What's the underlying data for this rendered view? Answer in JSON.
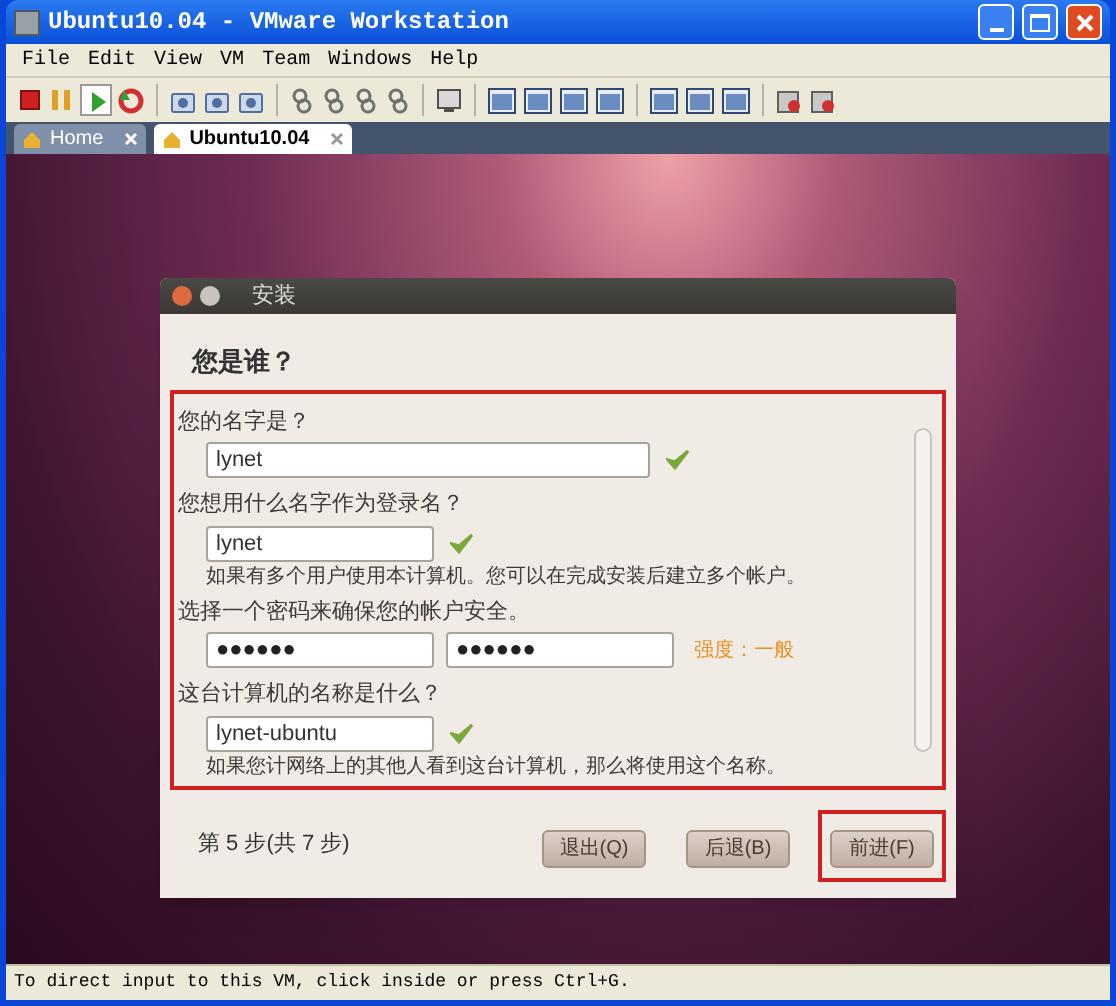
{
  "window": {
    "title": "Ubuntu10.04 - VMware Workstation"
  },
  "menu": [
    "File",
    "Edit",
    "View",
    "VM",
    "Team",
    "Windows",
    "Help"
  ],
  "toolbar": [
    {
      "kind": "stop"
    },
    {
      "kind": "pause"
    },
    {
      "kind": "play"
    },
    {
      "kind": "reset"
    },
    {
      "kind": "sep"
    },
    {
      "kind": "snapshot"
    },
    {
      "kind": "snapshot"
    },
    {
      "kind": "snapshot"
    },
    {
      "kind": "sep"
    },
    {
      "kind": "team"
    },
    {
      "kind": "team"
    },
    {
      "kind": "team"
    },
    {
      "kind": "team"
    },
    {
      "kind": "sep"
    },
    {
      "kind": "console"
    },
    {
      "kind": "sep"
    },
    {
      "kind": "view"
    },
    {
      "kind": "view"
    },
    {
      "kind": "view"
    },
    {
      "kind": "view"
    },
    {
      "kind": "sep"
    },
    {
      "kind": "view"
    },
    {
      "kind": "view"
    },
    {
      "kind": "view"
    },
    {
      "kind": "sep"
    },
    {
      "kind": "device"
    },
    {
      "kind": "device"
    }
  ],
  "tabs": [
    {
      "label": "Home",
      "selected": false
    },
    {
      "label": "Ubuntu10.04",
      "selected": true
    }
  ],
  "dialog": {
    "title": "安装",
    "heading": "您是谁？",
    "highlighted": true,
    "rows": [
      {
        "kind": "label",
        "text": "您的名字是？"
      },
      {
        "kind": "input",
        "value": "lynet",
        "wide": true,
        "valid": true
      },
      {
        "kind": "label",
        "text": "您想用什么名字作为登录名？"
      },
      {
        "kind": "input",
        "value": "lynet",
        "wide": false,
        "valid": true
      },
      {
        "kind": "hint",
        "text": "如果有多个用户使用本计算机。您可以在完成安装后建立多个帐户。"
      },
      {
        "kind": "label",
        "text": "选择一个密码来确保您的帐户安全。"
      },
      {
        "kind": "password",
        "value": "●●●●●●",
        "confirm": "●●●●●●",
        "strength": "强度：一般"
      },
      {
        "kind": "label",
        "text": "这台计算机的名称是什么？"
      },
      {
        "kind": "input",
        "value": "lynet-ubuntu",
        "wide": false,
        "valid": true
      },
      {
        "kind": "hint",
        "text": "如果您计网络上的其他人看到这台计算机，那么将使用这个名称。"
      }
    ],
    "step": "第 5 步(共 7 步)",
    "buttons": [
      {
        "label": "退出(Q)",
        "highlighted": false
      },
      {
        "label": "后退(B)",
        "highlighted": false
      },
      {
        "label": "前进(F)",
        "highlighted": true
      }
    ]
  },
  "status_bar": "To direct input to this VM, click inside or press Ctrl+G."
}
